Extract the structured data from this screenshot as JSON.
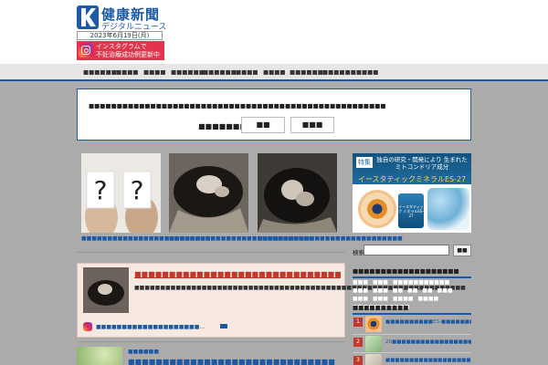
{
  "header": {
    "logo_title": "健康新聞",
    "logo_subtitle": "デジタルニュース",
    "date": "2023年6月19日(月)",
    "insta_line1": "インスタグラムで",
    "insta_line2": "不妊治療成功例更新中"
  },
  "nav": {
    "items": [
      "■■■■■■",
      "■■■■",
      "■■■■",
      "■■■■■■",
      "■■■■■■",
      "■■■■",
      "■■■■",
      "■■■■■■",
      "■■■■■■■■■■"
    ]
  },
  "notice": {
    "message": "■■■■■■■■■■■■■■■■■■■■■■■■■■■■■■■■■■■■■■■■■■■■■■■■■■■■■",
    "question": "■■■■■■■■■■■",
    "btn_yes": "■■",
    "btn_no": "■■■"
  },
  "photos": {
    "captions": [
      "■■■■■■■■■■■■■■■■■■■■■■■■■",
      "■■■■■■■■■■■■■■■■■■■■■■■■■■■■",
      "■■■■■■■■■■■■■■■■■■■■■■■■■■■■"
    ]
  },
  "featured": {
    "title": "■■■■■■■■■■■■■■■■■■■■■■■■■■■■■■■■■■■■■■■",
    "body": "■■■■■■■■■■■■■■■■■■■■■■■■■■■■■■■■■■■■■■■■■■■■■■■■■■■■■■■■■■■■■■■■",
    "link": "■■■■■■■■■■■■■■■■■■■■..."
  },
  "next_article": {
    "category": "■■■■■■",
    "title": "■■■■■■■■■■■■■■■■■■■■■■■■■■■■■■"
  },
  "ad": {
    "badge": "特集",
    "text1": "独自の研究・開発により 生まれたミトコンドリア成分",
    "text2": "イースタティックミネラルES-27",
    "bottle": "イースタティック ミネラルES-27"
  },
  "sidebar": {
    "search_label": "検索:",
    "search_value": "",
    "search_button": "■■",
    "tags_head": "■■■■■■■■■■■■■■■■■■■",
    "tags": [
      "■■■",
      "■■■",
      "■■■■■■■■■■■",
      "■■■",
      "■■■",
      "■■",
      "■■",
      "■■",
      "■■■",
      "■■■",
      "■■■",
      "■■■■",
      "■■■■",
      "■■■■■■■■■■■"
    ],
    "rank_head": "■■■■■■■■■■",
    "rank_items": [
      {
        "num": "1",
        "text": "■■■■■■■■■■ES-■■■■■■■■■■■■■■"
      },
      {
        "num": "2",
        "text": "20■■■■■■■■■■■■■■■■■■■■■■"
      },
      {
        "num": "3",
        "text": "■■■■■■■■■■■■■■■■■■■■■■■"
      }
    ]
  },
  "colors": {
    "accent": "#1d5aa6",
    "instagram": "#e3344d",
    "featured_title": "#c0392b",
    "rank_badge": "#c0392b"
  }
}
